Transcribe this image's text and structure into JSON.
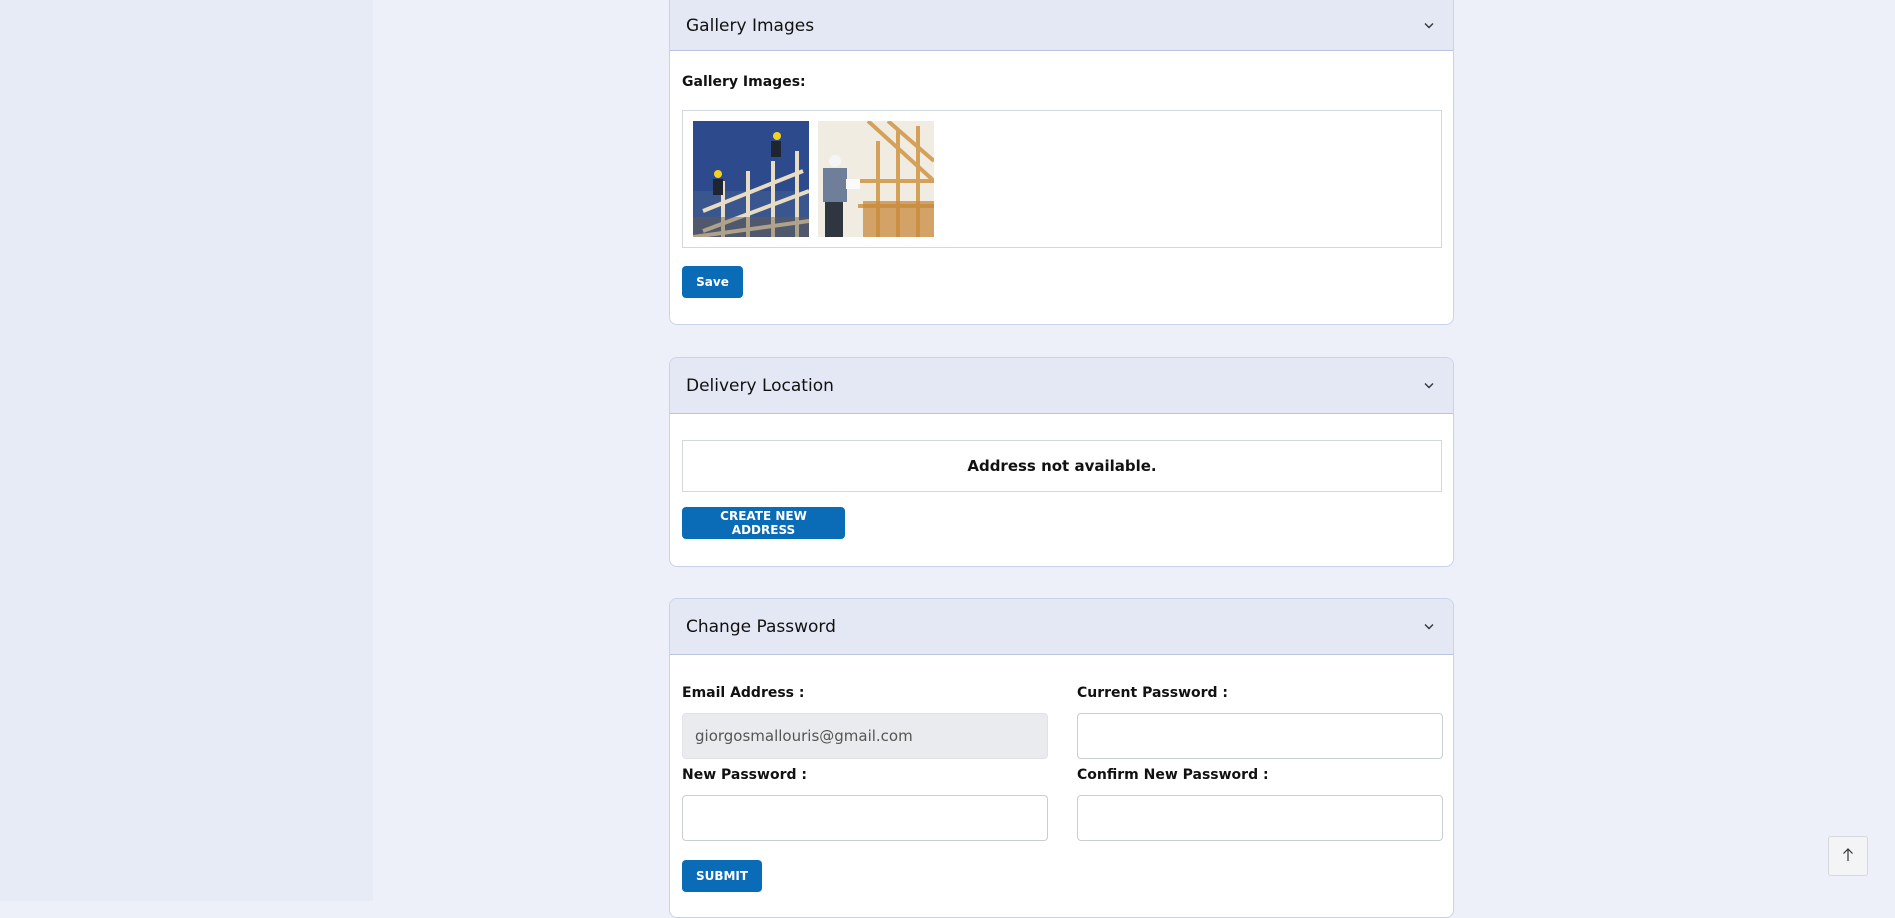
{
  "gallery": {
    "title": "Gallery Images",
    "field_label": "Gallery Images:",
    "images": [
      {
        "alt": "Construction workers on roof framing"
      },
      {
        "alt": "Builder inspecting wooden frame"
      }
    ],
    "save_label": "Save"
  },
  "delivery": {
    "title": "Delivery Location",
    "empty_message": "Address not available.",
    "create_label": "CREATE NEW ADDRESS"
  },
  "password": {
    "title": "Change Password",
    "email_label": "Email Address :",
    "email_value": "giorgosmallouris@gmail.com",
    "current_label": "Current Password :",
    "new_label": "New Password :",
    "confirm_label": "Confirm New Password :",
    "submit_label": "SUBMIT"
  },
  "colors": {
    "primary_button": "#0a6cb7",
    "panel_header": "#e4e8f4",
    "page_background": "#edf0f8"
  },
  "icons": {
    "collapse": "chevron-down-icon",
    "scroll_top": "arrow-up-icon"
  }
}
